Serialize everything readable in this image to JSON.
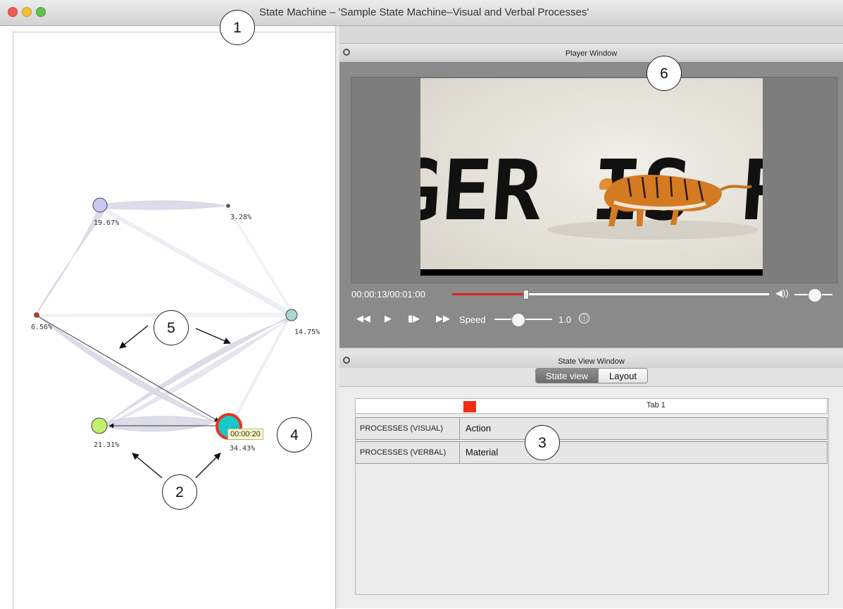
{
  "window": {
    "title": "State Machine – 'Sample State Machine–Visual and Verbal Processes'"
  },
  "graph": {
    "nodes": [
      {
        "id": "n1",
        "label": "19.67%",
        "color": "#c9c7f2"
      },
      {
        "id": "n2",
        "label": "3.28%",
        "color": "#6b5a3a"
      },
      {
        "id": "n3",
        "label": "6.56%",
        "color": "#c0391a"
      },
      {
        "id": "n4",
        "label": "14.75%",
        "color": "#a9d6d2"
      },
      {
        "id": "n5",
        "label": "21.31%",
        "color": "#c2f06a"
      },
      {
        "id": "n6",
        "label": "34.43%",
        "color": "#18c7c9",
        "highlight": "#e8351f"
      }
    ],
    "tooltip": "00:00:20"
  },
  "player": {
    "title": "Player Window",
    "video_text": "GER IS RUNNING",
    "time": "00:00:13/00:01:00",
    "progress": 0.23,
    "volume": 0.52,
    "speed_label": "Speed",
    "speed_value": "1.0",
    "speed_fraction": 0.4,
    "info_icon": "ⓘ"
  },
  "state_view": {
    "title": "State View Window",
    "tabs": [
      {
        "label": "State view",
        "active": true
      },
      {
        "label": "Layout",
        "active": false
      }
    ],
    "table": {
      "header": "Tab 1",
      "rows": [
        {
          "key": "PROCESSES (VISUAL)",
          "value": "Action"
        },
        {
          "key": "PROCESSES (VERBAL)",
          "value": "Material"
        }
      ]
    }
  },
  "callouts": [
    "1",
    "2",
    "3",
    "4",
    "5",
    "6"
  ]
}
